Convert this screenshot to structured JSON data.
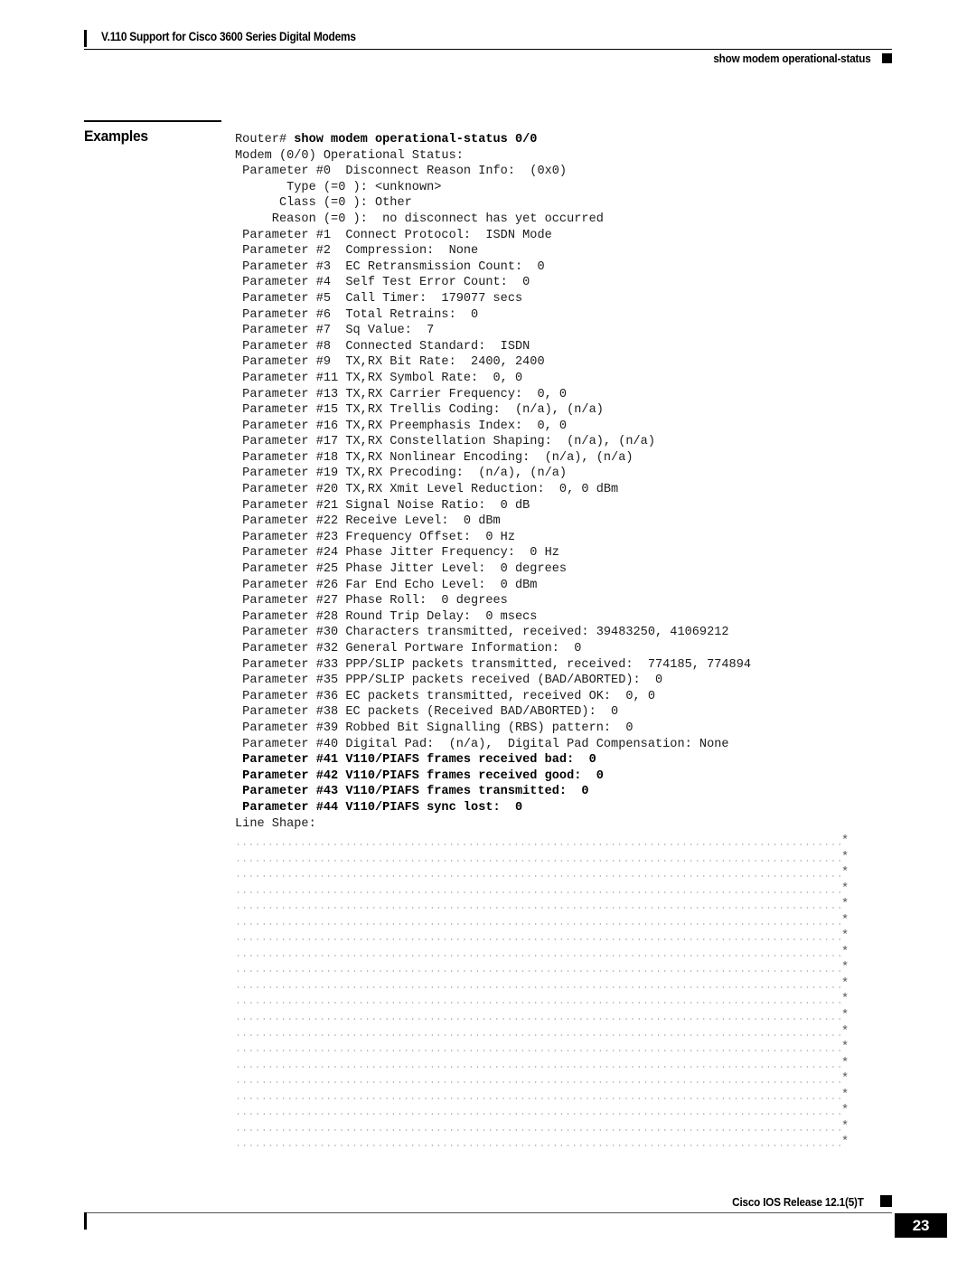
{
  "header": {
    "chapter_title": "V.110 Support for Cisco 3600 Series Digital Modems",
    "command_name": "show modem operational-status"
  },
  "section": {
    "label": "Examples"
  },
  "code_block": {
    "lines": [
      {
        "text": "Router# show modem operational-status 0/0",
        "bold_from": 8
      },
      {
        "text": "Modem (0/0) Operational Status:"
      },
      {
        "text": " Parameter #0  Disconnect Reason Info:  (0x0)"
      },
      {
        "text": "       Type (=0 ): <unknown>"
      },
      {
        "text": "      Class (=0 ): Other"
      },
      {
        "text": "     Reason (=0 ):  no disconnect has yet occurred"
      },
      {
        "text": " Parameter #1  Connect Protocol:  ISDN Mode"
      },
      {
        "text": " Parameter #2  Compression:  None"
      },
      {
        "text": " Parameter #3  EC Retransmission Count:  0"
      },
      {
        "text": " Parameter #4  Self Test Error Count:  0"
      },
      {
        "text": " Parameter #5  Call Timer:  179077 secs"
      },
      {
        "text": " Parameter #6  Total Retrains:  0"
      },
      {
        "text": " Parameter #7  Sq Value:  7"
      },
      {
        "text": " Parameter #8  Connected Standard:  ISDN"
      },
      {
        "text": " Parameter #9  TX,RX Bit Rate:  2400, 2400"
      },
      {
        "text": " Parameter #11 TX,RX Symbol Rate:  0, 0"
      },
      {
        "text": " Parameter #13 TX,RX Carrier Frequency:  0, 0"
      },
      {
        "text": " Parameter #15 TX,RX Trellis Coding:  (n/a), (n/a)"
      },
      {
        "text": " Parameter #16 TX,RX Preemphasis Index:  0, 0"
      },
      {
        "text": " Parameter #17 TX,RX Constellation Shaping:  (n/a), (n/a)"
      },
      {
        "text": " Parameter #18 TX,RX Nonlinear Encoding:  (n/a), (n/a)"
      },
      {
        "text": " Parameter #19 TX,RX Precoding:  (n/a), (n/a)"
      },
      {
        "text": " Parameter #20 TX,RX Xmit Level Reduction:  0, 0 dBm"
      },
      {
        "text": " Parameter #21 Signal Noise Ratio:  0 dB"
      },
      {
        "text": " Parameter #22 Receive Level:  0 dBm"
      },
      {
        "text": " Parameter #23 Frequency Offset:  0 Hz"
      },
      {
        "text": " Parameter #24 Phase Jitter Frequency:  0 Hz"
      },
      {
        "text": " Parameter #25 Phase Jitter Level:  0 degrees"
      },
      {
        "text": " Parameter #26 Far End Echo Level:  0 dBm"
      },
      {
        "text": " Parameter #27 Phase Roll:  0 degrees"
      },
      {
        "text": " Parameter #28 Round Trip Delay:  0 msecs"
      },
      {
        "text": " Parameter #30 Characters transmitted, received: 39483250, 41069212"
      },
      {
        "text": " Parameter #32 General Portware Information:  0"
      },
      {
        "text": " Parameter #33 PPP/SLIP packets transmitted, received:  774185, 774894"
      },
      {
        "text": " Parameter #35 PPP/SLIP packets received (BAD/ABORTED):  0"
      },
      {
        "text": " Parameter #36 EC packets transmitted, received OK:  0, 0"
      },
      {
        "text": " Parameter #38 EC packets (Received BAD/ABORTED):  0"
      },
      {
        "text": " Parameter #39 Robbed Bit Signalling (RBS) pattern:  0"
      },
      {
        "text": " Parameter #40 Digital Pad:  (n/a),  Digital Pad Compensation: None"
      },
      {
        "text": " Parameter #41 V110/PIAFS frames received bad:  0",
        "bold": true
      },
      {
        "text": " Parameter #42 V110/PIAFS frames received good:  0",
        "bold": true
      },
      {
        "text": " Parameter #43 V110/PIAFS frames transmitted:  0",
        "bold": true
      },
      {
        "text": " Parameter #44 V110/PIAFS sync lost:  0",
        "bold": true
      },
      {
        "text": "Line Shape:"
      }
    ]
  },
  "line_shape": {
    "row_count": 20,
    "dots_per_row": 94,
    "row_terminator": "*"
  },
  "footer": {
    "release": "Cisco IOS Release 12.1(5)T",
    "page_number": "23"
  }
}
